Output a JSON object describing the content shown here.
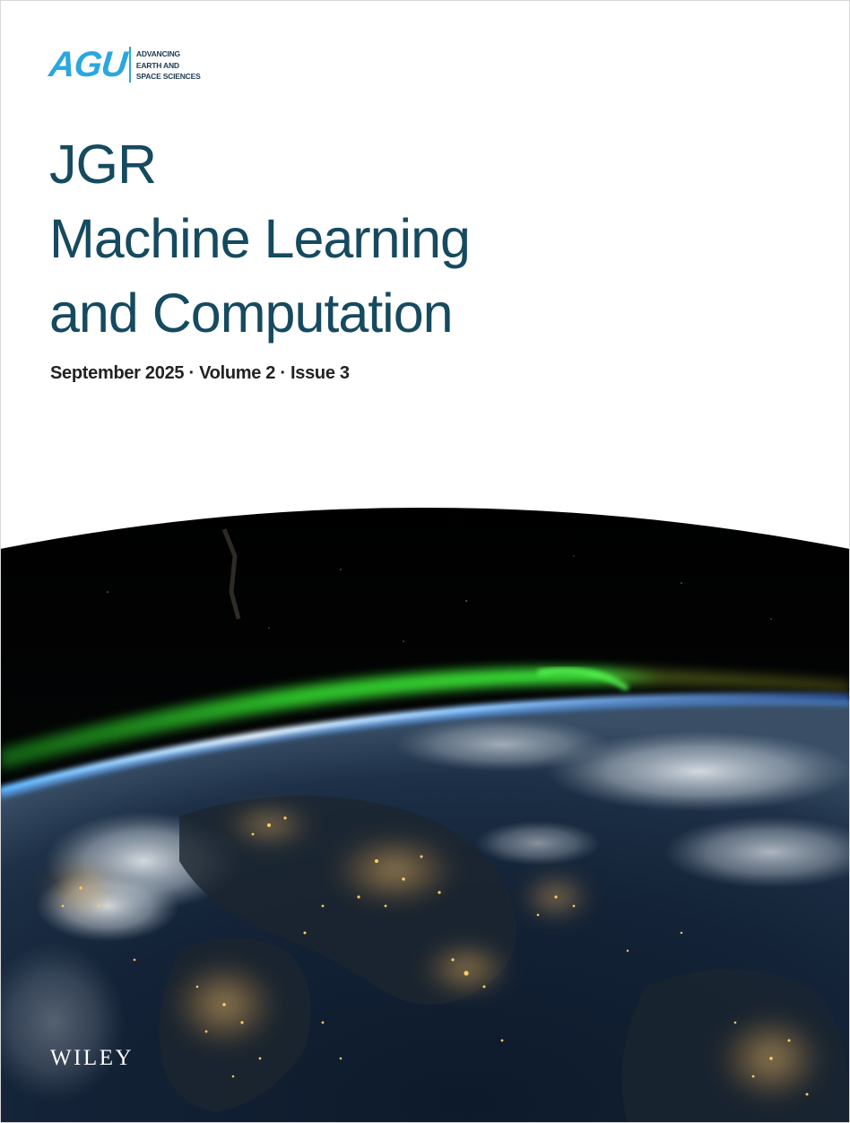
{
  "logo": {
    "mark": "AGU",
    "tagline": [
      "ADVANCING",
      "EARTH AND",
      "SPACE SCIENCES"
    ]
  },
  "title": {
    "line1": "JGR",
    "line2": "Machine Learning",
    "line3": "and Computation"
  },
  "issue_line": "September 2025 · Volume 2 · Issue 3",
  "publisher": "WILEY",
  "colors": {
    "title": "#154a5f",
    "logo_blue": "#2aa7df",
    "aurora": "#33d42e",
    "city_lights": "#ffb347"
  }
}
